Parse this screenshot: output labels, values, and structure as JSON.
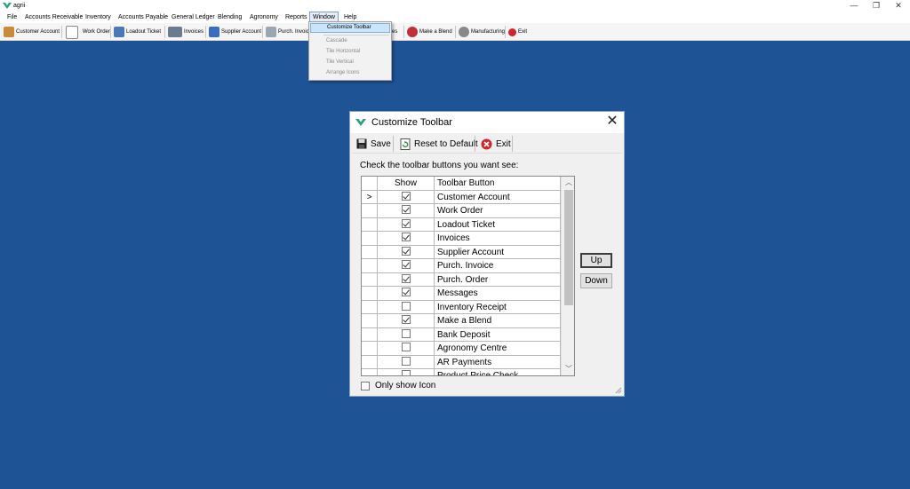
{
  "app": {
    "title": "agrii"
  },
  "window_controls": {
    "minimize": "—",
    "restore": "❐",
    "close": "✕"
  },
  "menubar": [
    "File",
    "Accounts Receivable",
    "Inventory",
    "Accounts Payable",
    "General Ledger",
    "Blending",
    "Agronomy",
    "Reports",
    "Window",
    "Help"
  ],
  "toolbar": [
    {
      "label": "Customer Account",
      "icon": "people-icon"
    },
    {
      "label": "Work Order",
      "icon": "document-icon"
    },
    {
      "label": "Loadout Ticket",
      "icon": "truck-icon"
    },
    {
      "label": "Invoices",
      "icon": "calculator-icon"
    },
    {
      "label": "Supplier Account",
      "icon": "people-icon"
    },
    {
      "label": "Purch. Invoic",
      "icon": "truck-icon"
    },
    {
      "label": "es",
      "icon": ""
    },
    {
      "label": "Make a Blend",
      "icon": "blend-icon"
    },
    {
      "label": "Manufacturing",
      "icon": "gear-icon"
    },
    {
      "label": "Exit",
      "icon": "exit-icon"
    }
  ],
  "window_menu": {
    "items": [
      "Customize Toolbar",
      "Cascade",
      "Tile Horizontal",
      "Tile Vertical",
      "Arrange Icons"
    ]
  },
  "dialog": {
    "title": "Customize Toolbar",
    "toolbar": {
      "save": "Save",
      "reset": "Reset to Default",
      "exit": "Exit"
    },
    "instruction": "Check the toolbar buttons you want see:",
    "columns": {
      "show": "Show",
      "name": "Toolbar Button"
    },
    "current_row_marker": ">",
    "rows": [
      {
        "name": "Customer Account",
        "show": true
      },
      {
        "name": "Work Order",
        "show": true
      },
      {
        "name": "Loadout Ticket",
        "show": true
      },
      {
        "name": "Invoices",
        "show": true
      },
      {
        "name": "Supplier Account",
        "show": true
      },
      {
        "name": "Purch. Invoice",
        "show": true
      },
      {
        "name": "Purch. Order",
        "show": true
      },
      {
        "name": "Messages",
        "show": true
      },
      {
        "name": "Inventory Receipt",
        "show": false
      },
      {
        "name": "Make a Blend",
        "show": true
      },
      {
        "name": "Bank Deposit",
        "show": false
      },
      {
        "name": "Agronomy Centre",
        "show": false
      },
      {
        "name": "AR Payments",
        "show": false
      },
      {
        "name": "Product Price Check",
        "show": false
      }
    ],
    "up_button": "Up",
    "down_button": "Down",
    "only_show_icon": "Only show Icon",
    "only_show_icon_checked": false
  },
  "colors": {
    "desktop": "#1e5496",
    "accent": "#2e9e7a"
  }
}
